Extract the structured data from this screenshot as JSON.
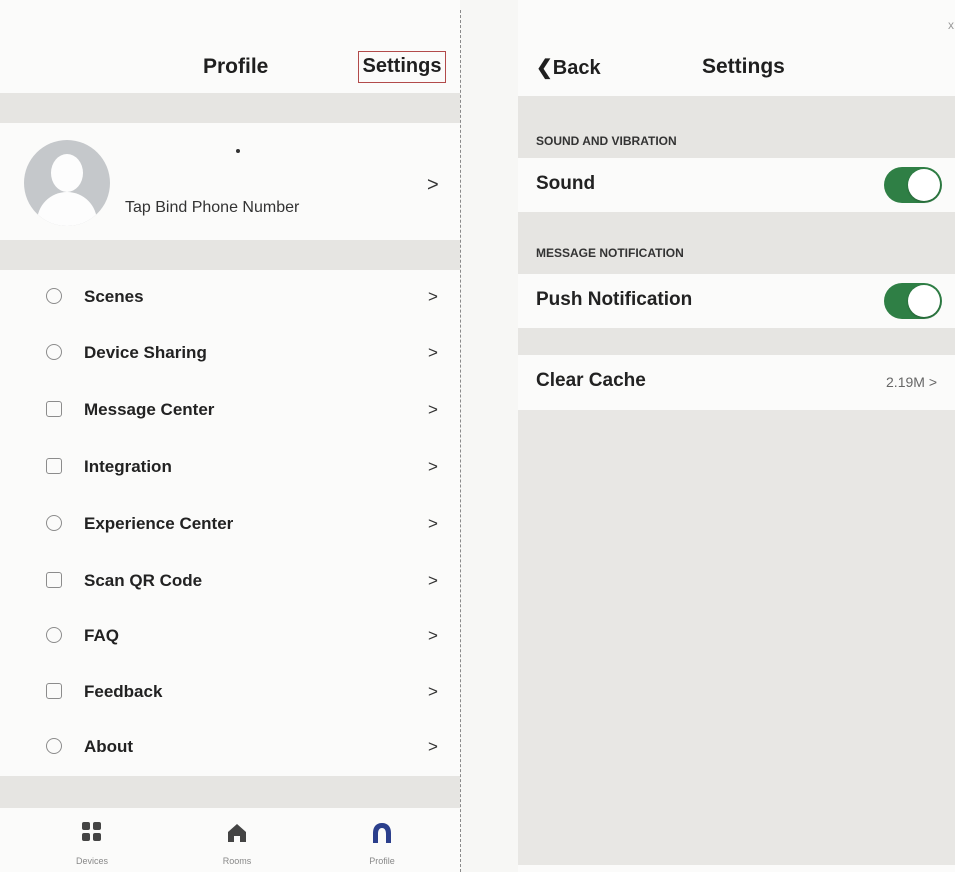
{
  "profile_screen": {
    "title": "Profile",
    "settings_link": "Settings",
    "bind_phone": "Tap Bind Phone Number",
    "chevron": ">",
    "menu": [
      {
        "label": "Scenes",
        "icon": "scenes-icon"
      },
      {
        "label": "Device Sharing",
        "icon": "share-icon"
      },
      {
        "label": "Message Center",
        "icon": "message-icon"
      },
      {
        "label": "Integration",
        "icon": "integration-icon"
      },
      {
        "label": "Experience Center",
        "icon": "heart-icon"
      },
      {
        "label": "Scan QR Code",
        "icon": "qr-code-icon"
      },
      {
        "label": "FAQ",
        "icon": "question-icon"
      },
      {
        "label": "Feedback",
        "icon": "feedback-icon"
      },
      {
        "label": "About",
        "icon": "info-icon"
      }
    ],
    "tabs": [
      {
        "label": "Devices",
        "icon": "grid-icon"
      },
      {
        "label": "Rooms",
        "icon": "house-icon"
      },
      {
        "label": "Profile",
        "icon": "profile-icon"
      }
    ],
    "accent_color": "#2b3f8c"
  },
  "settings_screen": {
    "back_label": "Back",
    "title": "Settings",
    "close_mark": "x",
    "sections": [
      {
        "header": "SOUND AND VIBRATION",
        "row_label": "Sound",
        "toggle_on": true
      },
      {
        "header": "MESSAGE NOTIFICATION",
        "row_label": "Push Notification",
        "toggle_on": true
      }
    ],
    "clear_cache": {
      "label": "Clear Cache",
      "value": "2.19M >"
    },
    "toggle_color": "#2f7f45"
  }
}
